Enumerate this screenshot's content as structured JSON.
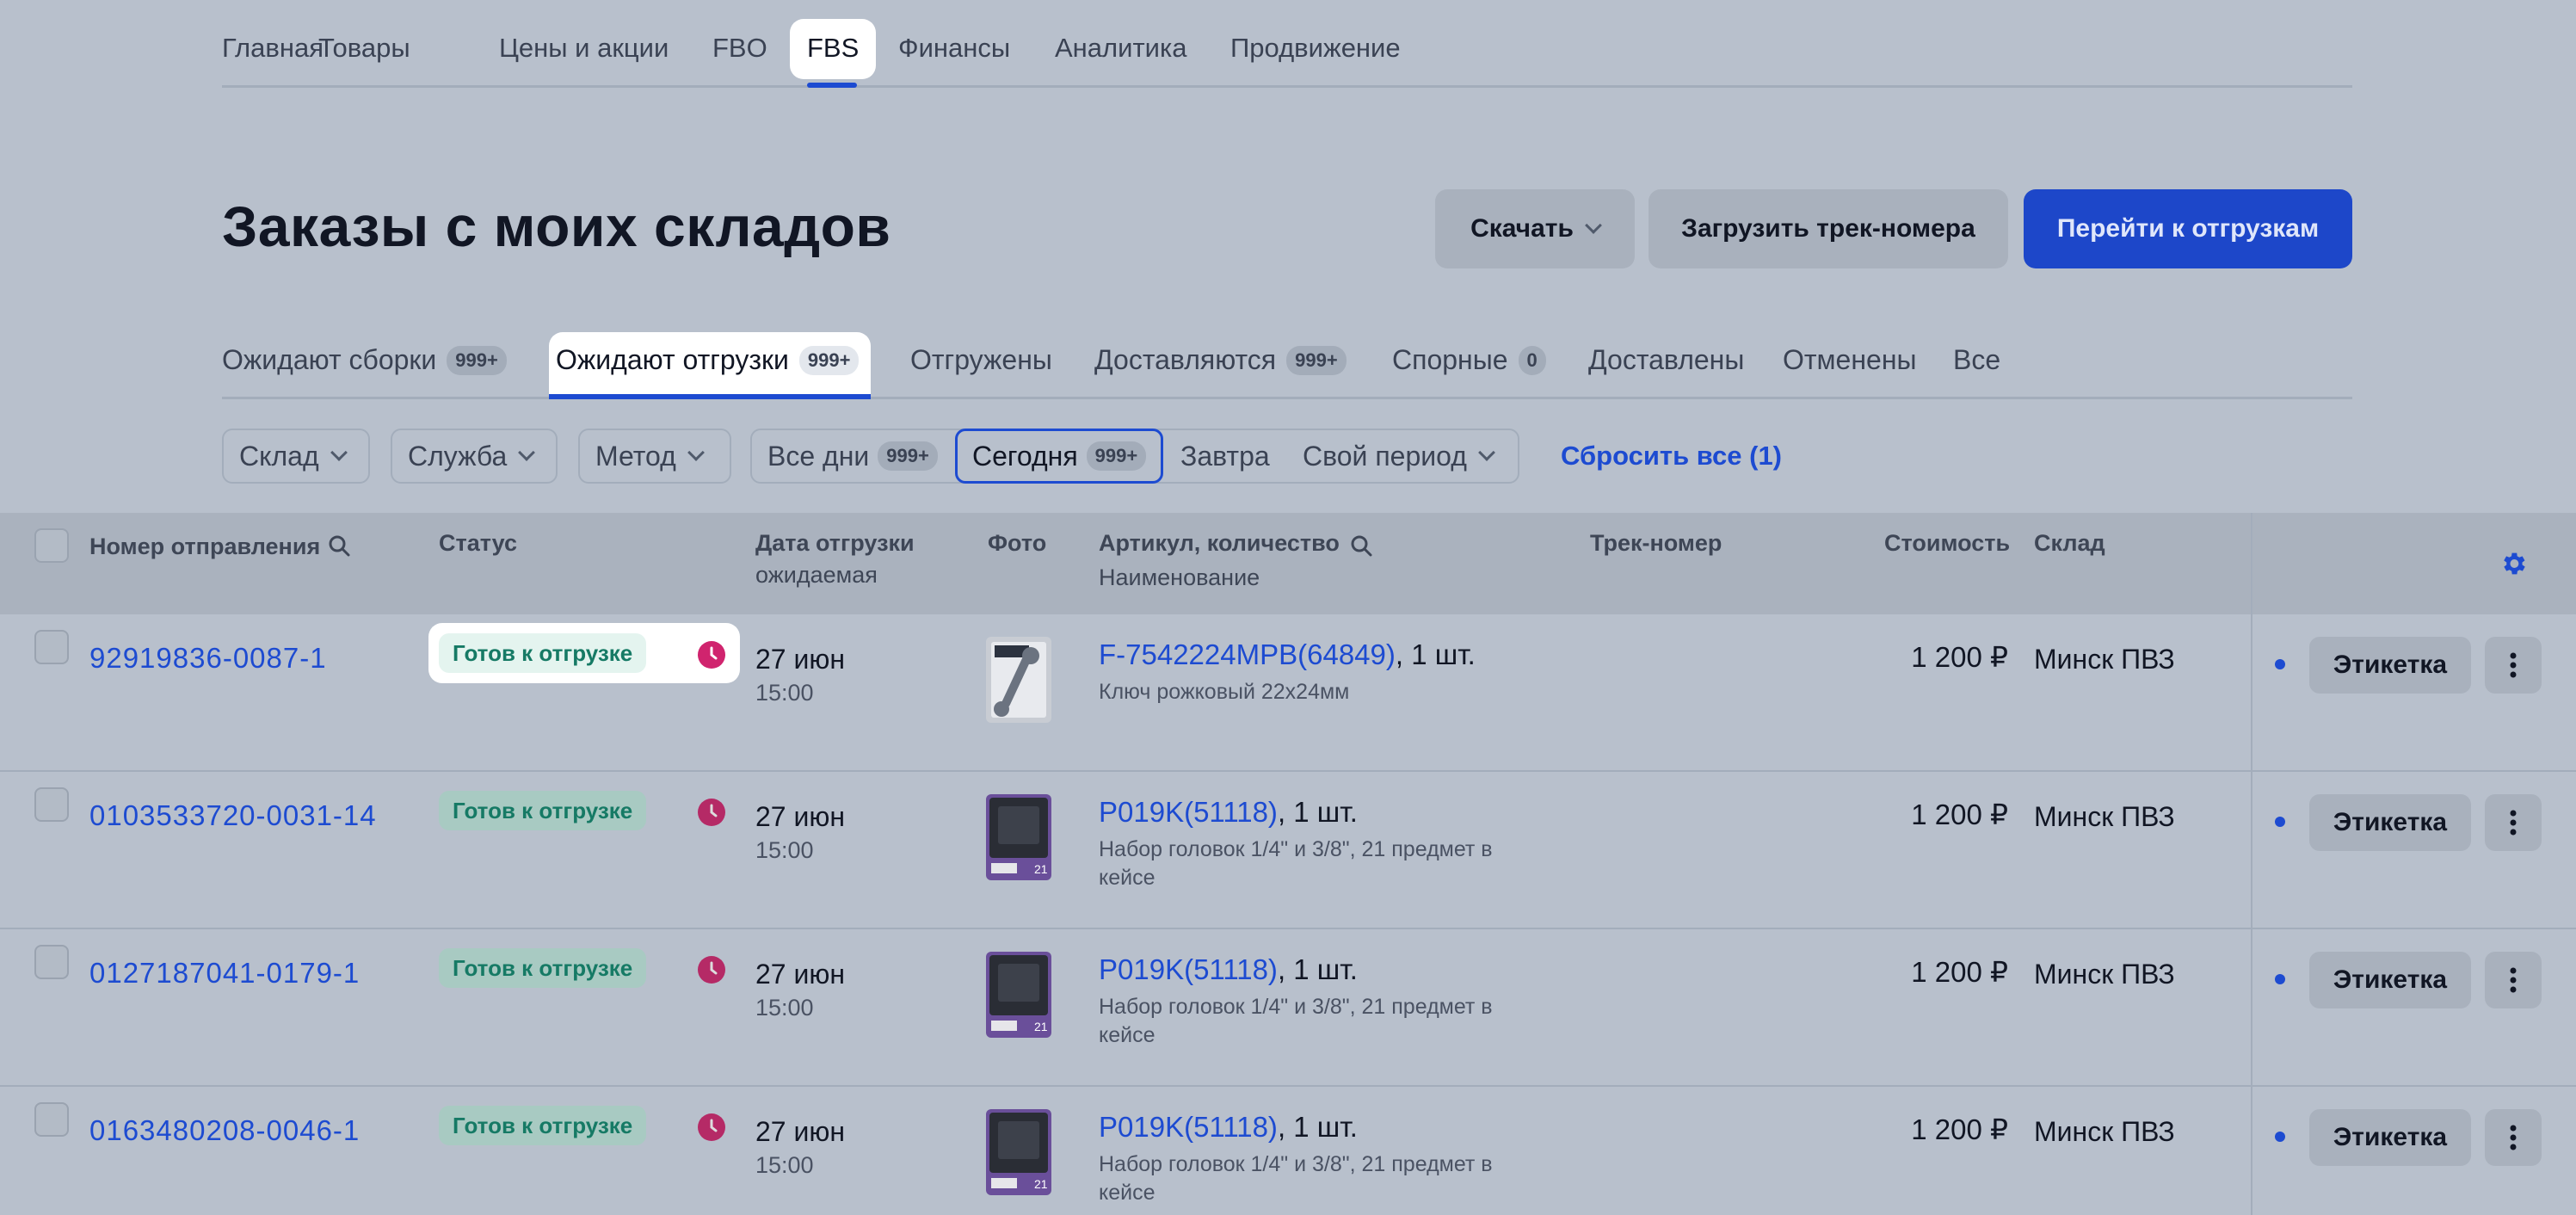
{
  "nav": {
    "items": [
      "Главная",
      "Товары",
      "Цены и акции",
      "FBO",
      "FBS",
      "Финансы",
      "Аналитика",
      "Продвижение"
    ],
    "active": "FBS"
  },
  "page_title": "Заказы с моих складов",
  "actions": {
    "download": "Скачать",
    "upload_tracks": "Загрузить трек-номера",
    "go_to_shipments": "Перейти к отгрузкам"
  },
  "tabs": [
    {
      "label": "Ожидают сборки",
      "count": "999+"
    },
    {
      "label": "Ожидают отгрузки",
      "count": "999+"
    },
    {
      "label": "Отгружены",
      "count": ""
    },
    {
      "label": "Доставляются",
      "count": "999+"
    },
    {
      "label": "Спорные",
      "count": "0"
    },
    {
      "label": "Доставлены",
      "count": ""
    },
    {
      "label": "Отменены",
      "count": ""
    },
    {
      "label": "Все",
      "count": ""
    }
  ],
  "filters": {
    "warehouse": "Склад",
    "service": "Служба",
    "method": "Метод",
    "all_days": "Все дни",
    "all_days_count": "999+",
    "today": "Сегодня",
    "today_count": "999+",
    "tomorrow": "Завтра",
    "custom_period": "Свой период",
    "reset": "Сбросить все (1)"
  },
  "table": {
    "headers": {
      "order_number": "Номер отправления",
      "status": "Статус",
      "ship_date": "Дата отгрузки",
      "ship_date_sub": "ожидаемая",
      "photo": "Фото",
      "sku": "Артикул, количество",
      "sku_sub": "Наименование",
      "track": "Трек-номер",
      "price": "Стоимость",
      "warehouse": "Склад"
    },
    "rows": [
      {
        "order": "92919836-0087-1",
        "status": "Готов к отгрузке",
        "date": "27 июн",
        "time": "15:00",
        "sku": "F-7542224MPB(64849)",
        "qty": ", 1 шт.",
        "name": "Ключ рожковый 22х24мм",
        "price": "1 200 ₽",
        "warehouse": "Минск ПВЗ",
        "label_btn": "Этикетка"
      },
      {
        "order": "0103533720-0031-14",
        "status": "Готов к отгрузке",
        "date": "27 июн",
        "time": "15:00",
        "sku": "P019K(51118)",
        "qty": ", 1 шт.",
        "name": "Набор головок 1/4\" и 3/8\", 21 предмет в кейсе",
        "price": "1 200 ₽",
        "warehouse": "Минск ПВЗ",
        "label_btn": "Этикетка"
      },
      {
        "order": "0127187041-0179-1",
        "status": "Готов к отгрузке",
        "date": "27 июн",
        "time": "15:00",
        "sku": "P019K(51118)",
        "qty": ", 1 шт.",
        "name": "Набор головок 1/4\" и 3/8\", 21 предмет в кейсе",
        "price": "1 200 ₽",
        "warehouse": "Минск ПВЗ",
        "label_btn": "Этикетка"
      },
      {
        "order": "0163480208-0046-1",
        "status": "Готов к отгрузке",
        "date": "27 июн",
        "time": "15:00",
        "sku": "P019K(51118)",
        "qty": ", 1 шт.",
        "name": "Набор головок 1/4\" и 3/8\", 21 предмет в кейсе",
        "price": "1 200 ₽",
        "warehouse": "Минск ПВЗ",
        "label_btn": "Этикетка"
      }
    ]
  },
  "colors": {
    "accent": "#1d4bd1",
    "status_green": "#167a65",
    "clock_pink": "#d0246e",
    "overlay_bg": "#b8c0cc"
  }
}
